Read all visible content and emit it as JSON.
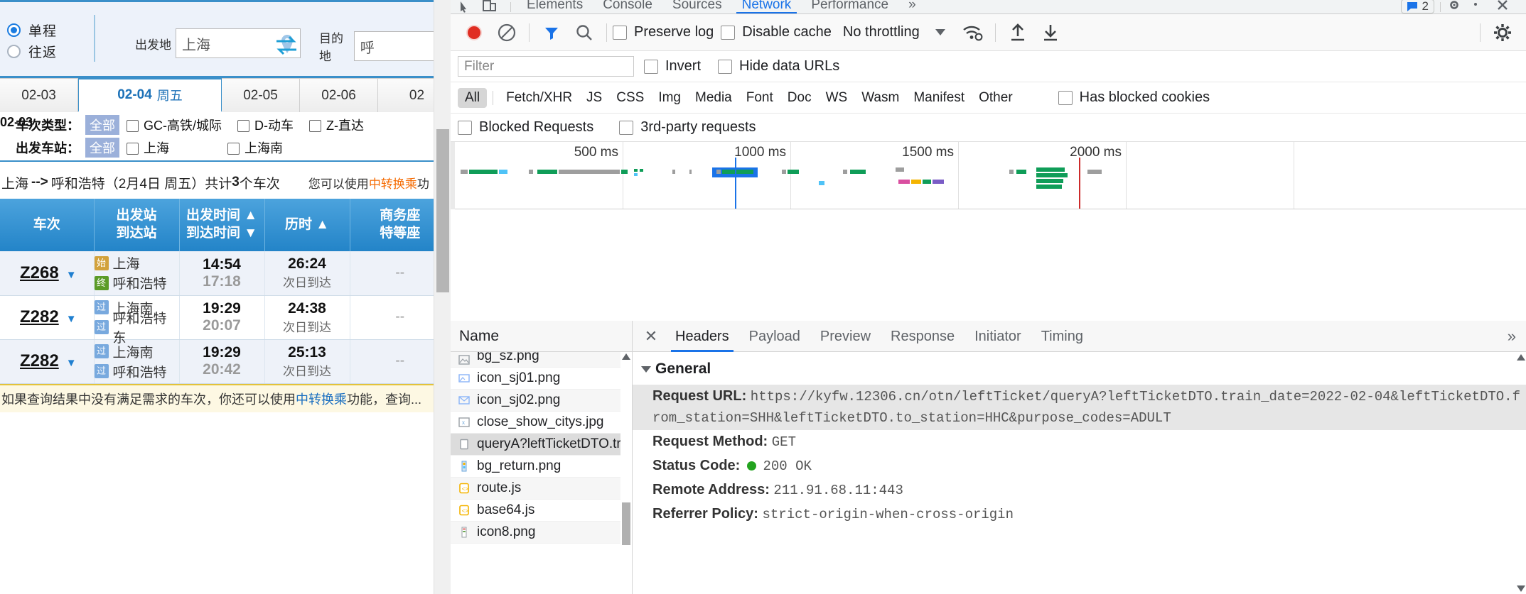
{
  "page": {
    "trip": {
      "options": [
        {
          "label": "单程",
          "selected": true
        },
        {
          "label": "往返",
          "selected": false
        }
      ]
    },
    "from": {
      "label": "出发地",
      "value": "上海"
    },
    "to": {
      "label": "目的地",
      "value": "呼"
    },
    "date_tabs": [
      {
        "date": "02-03",
        "weekday": "",
        "selected": false
      },
      {
        "date": "02-04",
        "weekday": "周五",
        "selected": true
      },
      {
        "date": "02-05",
        "weekday": "",
        "selected": false
      },
      {
        "date": "02-06",
        "weekday": "",
        "selected": false
      },
      {
        "date": "02",
        "weekday": "",
        "selected": false
      }
    ],
    "ghost_date": "02-03",
    "filters": [
      {
        "label": "车次类型：",
        "all": "全部",
        "options": [
          {
            "label": "GC-高铁/城际"
          },
          {
            "label": "D-动车"
          },
          {
            "label": "Z-直达"
          }
        ]
      },
      {
        "label": "出发车站：",
        "all": "全部",
        "options": [
          {
            "label": "上海"
          },
          {
            "label": "上海南"
          }
        ]
      }
    ],
    "summary": {
      "route_from": "上海",
      "arrow": "-->",
      "route_to": "呼和浩特",
      "date_paren": "（2月4日 周五）",
      "count_prefix": "共计",
      "count": "3",
      "count_suffix": "个车次",
      "hint_pre": "您可以使用",
      "hint_link": "中转换乘",
      "hint_post": "功"
    },
    "table": {
      "headers": [
        {
          "line1": "车次",
          "line2": ""
        },
        {
          "line1": "出发站",
          "line2": "到达站"
        },
        {
          "line1": "出发时间 ▲",
          "line2": "到达时间 ▼"
        },
        {
          "line1": "历时 ▲",
          "line2": ""
        },
        {
          "line1": "商务座",
          "line2": "特等座"
        }
      ],
      "rows": [
        {
          "train": "Z268",
          "from_tag": "始",
          "from_tag_type": "start",
          "from_station": "上海",
          "to_tag": "终",
          "to_tag_type": "end",
          "to_station": "呼和浩特",
          "depart": "14:54",
          "arrive": "17:18",
          "duration": "26:24",
          "duration_note": "次日到达",
          "business": "--"
        },
        {
          "train": "Z282",
          "from_tag": "过",
          "from_tag_type": "pass",
          "from_station": "上海南",
          "to_tag": "过",
          "to_tag_type": "pass",
          "to_station": "呼和浩特东",
          "depart": "19:29",
          "arrive": "20:07",
          "duration": "24:38",
          "duration_note": "次日到达",
          "business": "--"
        },
        {
          "train": "Z282",
          "from_tag": "过",
          "from_tag_type": "pass",
          "from_station": "上海南",
          "to_tag": "过",
          "to_tag_type": "pass",
          "to_station": "呼和浩特",
          "depart": "19:29",
          "arrive": "20:42",
          "duration": "25:13",
          "duration_note": "次日到达",
          "business": "--"
        }
      ]
    },
    "yellow_note": {
      "pre": "如果查询结果中没有满足需求的车次，你还可以使用",
      "link": "中转换乘",
      "post": "功能，查询..."
    }
  },
  "devtools": {
    "tabs": [
      {
        "label": "Elements",
        "active": false
      },
      {
        "label": "Console",
        "active": false
      },
      {
        "label": "Sources",
        "active": false
      },
      {
        "label": "Network",
        "active": true
      },
      {
        "label": "Performance",
        "active": false
      },
      {
        "label": "»",
        "active": false
      }
    ],
    "issues_count": "2",
    "toolbar": {
      "record_title": "record",
      "clear_title": "clear",
      "filter_title": "filter",
      "search_title": "search",
      "preserve_log": "Preserve log",
      "disable_cache": "Disable cache",
      "throttling": "No throttling",
      "settings_title": "settings"
    },
    "filter_row": {
      "placeholder": "Filter",
      "invert": "Invert",
      "hide_data_urls": "Hide data URLs"
    },
    "types": [
      "All",
      "Fetch/XHR",
      "JS",
      "CSS",
      "Img",
      "Media",
      "Font",
      "Doc",
      "WS",
      "Wasm",
      "Manifest",
      "Other"
    ],
    "selected_type": "All",
    "has_blocked_cookies": "Has blocked cookies",
    "blocked_requests": "Blocked Requests",
    "third_party": "3rd-party requests",
    "overview_ticks": [
      "500 ms",
      "1000 ms",
      "1500 ms",
      "2000 ms"
    ],
    "names_header": "Name",
    "requests": [
      {
        "name": "bg_sz.png",
        "icon": "image-icon",
        "selected": false,
        "partial": true
      },
      {
        "name": "icon_sj01.png",
        "icon": "image-icon",
        "selected": false
      },
      {
        "name": "icon_sj02.png",
        "icon": "image-icon",
        "selected": false
      },
      {
        "name": "close_show_citys.jpg",
        "icon": "image-broken-icon",
        "selected": false
      },
      {
        "name": "queryA?leftTicketDTO.tr",
        "icon": "doc-icon",
        "selected": true
      },
      {
        "name": "bg_return.png",
        "icon": "image-thumb-icon",
        "selected": false
      },
      {
        "name": "route.js",
        "icon": "script-icon",
        "selected": false
      },
      {
        "name": "base64.js",
        "icon": "script-icon",
        "selected": false
      },
      {
        "name": "icon8.png",
        "icon": "image-thumb-icon",
        "selected": false
      }
    ],
    "detail_tabs": [
      {
        "label": "Headers",
        "active": true
      },
      {
        "label": "Payload",
        "active": false
      },
      {
        "label": "Preview",
        "active": false
      },
      {
        "label": "Response",
        "active": false
      },
      {
        "label": "Initiator",
        "active": false
      },
      {
        "label": "Timing",
        "active": false
      }
    ],
    "detail_more": "»",
    "general_label": "General",
    "general": [
      {
        "key": "Request URL:",
        "value": "https://kyfw.12306.cn/otn/leftTicket/queryA?leftTicketDTO.train_date=2022-02-04&leftTicketDTO.from_station=SHH&leftTicketDTO.to_station=HHC&purpose_codes=ADULT",
        "highlight": true
      },
      {
        "key": "Request Method:",
        "value": "GET",
        "highlight": false
      },
      {
        "key": "Status Code:",
        "value": "200 OK",
        "status_dot": true,
        "highlight": false
      },
      {
        "key": "Remote Address:",
        "value": "211.91.68.11:443",
        "highlight": false
      },
      {
        "key": "Referrer Policy:",
        "value": "strict-origin-when-cross-origin",
        "highlight": false
      }
    ]
  }
}
